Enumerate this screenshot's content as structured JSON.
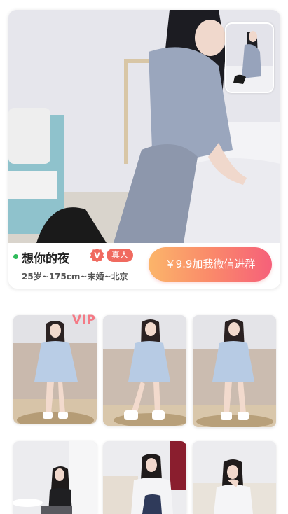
{
  "profile": {
    "name": "想你的夜",
    "badge_v": "V",
    "badge_real": "真人",
    "meta": "25岁~175cm~未婚~北京",
    "cta_label": "￥9.9加我微信进群",
    "online_color": "#2fbb5b"
  },
  "gallery": {
    "vip_label": "VIP",
    "tiles": [
      {
        "name": "photo-1"
      },
      {
        "name": "photo-2"
      },
      {
        "name": "photo-3"
      },
      {
        "name": "photo-4"
      },
      {
        "name": "photo-5"
      },
      {
        "name": "photo-6"
      }
    ]
  },
  "colors": {
    "cta_gradient_start": "#fbb56a",
    "cta_gradient_end": "#f6607a",
    "real_badge": "#f06a5f",
    "vip": "#f47a85"
  }
}
